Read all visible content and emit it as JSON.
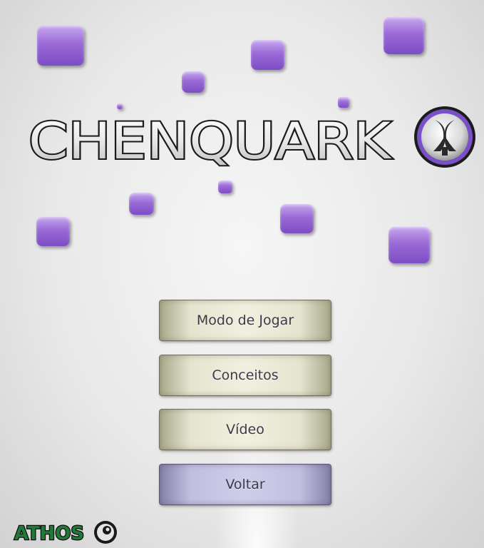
{
  "game": {
    "title": "CHENQUARK",
    "publisher_logo_text": "ATHOS"
  },
  "menu": {
    "items": [
      {
        "label": "Modo de Jogar",
        "active": false
      },
      {
        "label": "Conceitos",
        "active": false
      },
      {
        "label": "Vídeo",
        "active": false
      },
      {
        "label": "Voltar",
        "active": true
      }
    ]
  },
  "colors": {
    "accent": "#8a5bd0",
    "button": "#e5e4cf",
    "button_active": "#c0bfe0"
  },
  "icons": [
    "quark-emblem-icon",
    "athos-emblem-icon"
  ]
}
